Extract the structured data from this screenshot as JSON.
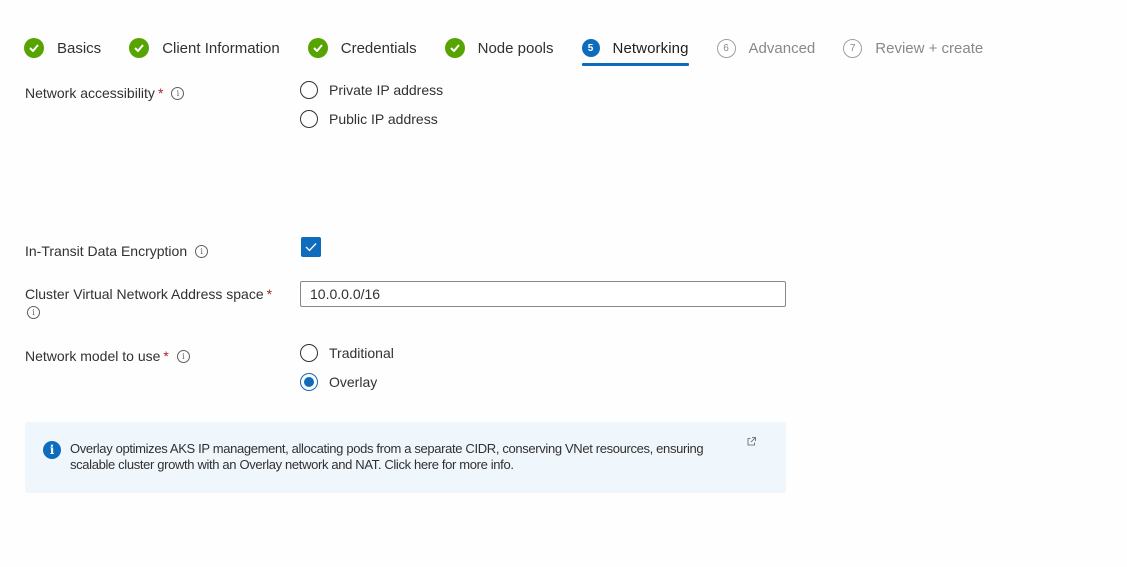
{
  "wizard": {
    "steps": [
      {
        "number": "1",
        "label": "Basics",
        "state": "done"
      },
      {
        "number": "2",
        "label": "Client Information",
        "state": "done"
      },
      {
        "number": "3",
        "label": "Credentials",
        "state": "done"
      },
      {
        "number": "4",
        "label": "Node pools",
        "state": "done"
      },
      {
        "number": "5",
        "label": "Networking",
        "state": "active"
      },
      {
        "number": "6",
        "label": "Advanced",
        "state": "todo"
      },
      {
        "number": "7",
        "label": "Review + create",
        "state": "todo"
      }
    ]
  },
  "form": {
    "network_accessibility": {
      "label": "Network accessibility",
      "required_mark": "*",
      "options": [
        "Private IP address",
        "Public IP address"
      ],
      "selected": null
    },
    "in_transit_encryption": {
      "label": "In-Transit Data Encryption",
      "checked": true
    },
    "address_space": {
      "label": "Cluster Virtual Network Address space",
      "required_mark": "*",
      "value": "10.0.0.0/16"
    },
    "network_model": {
      "label": "Network model to use",
      "required_mark": "*",
      "options": [
        "Traditional",
        "Overlay"
      ],
      "selected": "Overlay"
    }
  },
  "info_banner": {
    "text": "Overlay optimizes AKS IP management, allocating pods from a separate CIDR, conserving VNet resources, ensuring scalable cluster growth with an Overlay network and NAT. Click here for more info.",
    "icon": "info-icon",
    "link_icon": "external-link-icon"
  },
  "colors": {
    "accent": "#0f6cbd",
    "success": "#57a300",
    "required": "#a4262c",
    "banner_bg": "#eff6fc"
  }
}
